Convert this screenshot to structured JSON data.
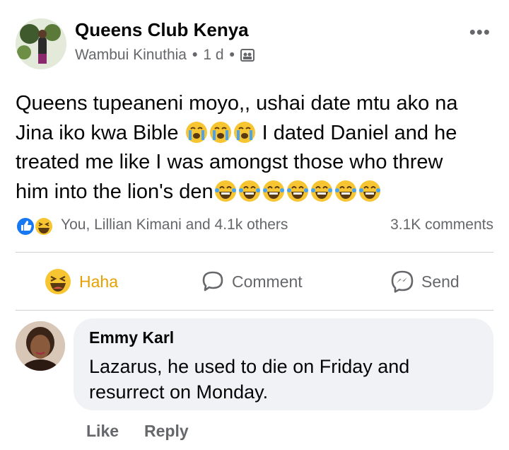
{
  "post": {
    "group_name": "Queens Club Kenya",
    "author": "Wambui Kinuthia",
    "time": "1 d",
    "separator": "•",
    "more_label": "•••",
    "body_line1": "Queens tupeaneni moyo,, ushai date mtu ako na",
    "body_line2a": "Jina iko kwa Bible",
    "body_line2b": "I dated Daniel and he",
    "body_line3": "treated me like I was amongst those who threw",
    "body_line4": "him into the lion's den"
  },
  "reactions": {
    "summary": "You, Lillian Kimani and 4.1k others",
    "comments_count": "3.1K comments",
    "icons": [
      "like-icon",
      "haha-icon"
    ]
  },
  "actions": {
    "haha_label": "Haha",
    "comment_label": "Comment",
    "send_label": "Send"
  },
  "comment": {
    "name": "Emmy Karl",
    "text_line1": "Lazarus, he used to die on Friday and",
    "text_line2": "resurrect on Monday.",
    "like_label": "Like",
    "reply_label": "Reply"
  },
  "colors": {
    "secondary_text": "#65676b",
    "haha_accent": "#e6a100",
    "like_blue": "#1877f2",
    "bubble_bg": "#f0f2f5"
  }
}
